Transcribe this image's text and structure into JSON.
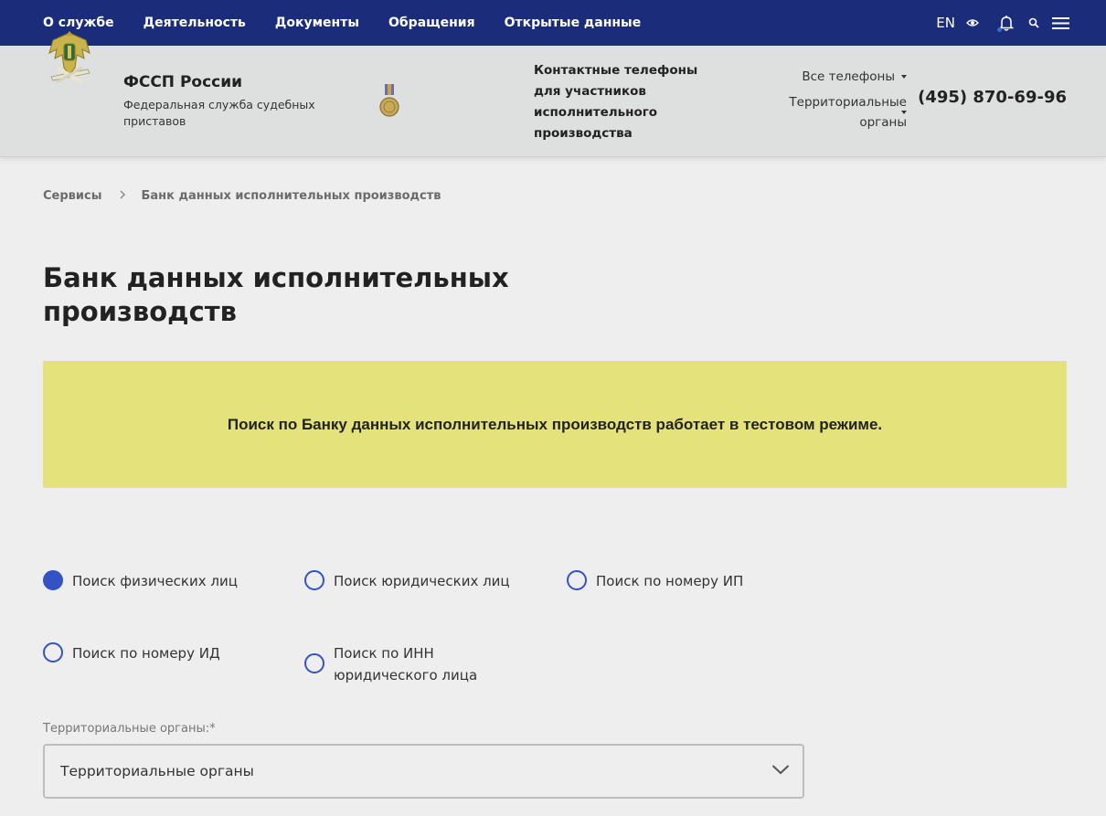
{
  "topnav": {
    "items": [
      "О службе",
      "Деятельность",
      "Документы",
      "Обращения",
      "Открытые данные"
    ],
    "lang": "EN"
  },
  "header": {
    "org_name": "ФССП России",
    "org_subtitle": "Федеральная служба судебных приставов",
    "contacts_title": "Контактные телефоны для участников исполнительного производства",
    "all_phones": "Все телефоны",
    "territorial": "Территориальные органы",
    "phone": "(495) 870-69-96"
  },
  "breadcrumb": {
    "root": "Сервисы",
    "current": "Банк данных исполнительных производств"
  },
  "page": {
    "title": "Банк данных исполнительных производств",
    "banner": "Поиск по Банку данных исполнительных производств работает в тестовом режиме."
  },
  "search_options": {
    "options": [
      {
        "label": "Поиск физических лиц",
        "checked": true
      },
      {
        "label": "Поиск юридических лиц",
        "checked": false
      },
      {
        "label": "Поиск по номеру ИП",
        "checked": false
      },
      {
        "label": "Поиск по номеру ИД",
        "checked": false
      },
      {
        "label": "Поиск по ИНН юридического лица",
        "checked": false
      }
    ]
  },
  "form": {
    "territorial_label": "Территориальные органы:*",
    "territorial_value": "Территориальные органы"
  },
  "colors": {
    "nav_bg": "#1b2d7a",
    "banner_bg": "#e4e27a",
    "radio_accent": "#3353c4"
  }
}
